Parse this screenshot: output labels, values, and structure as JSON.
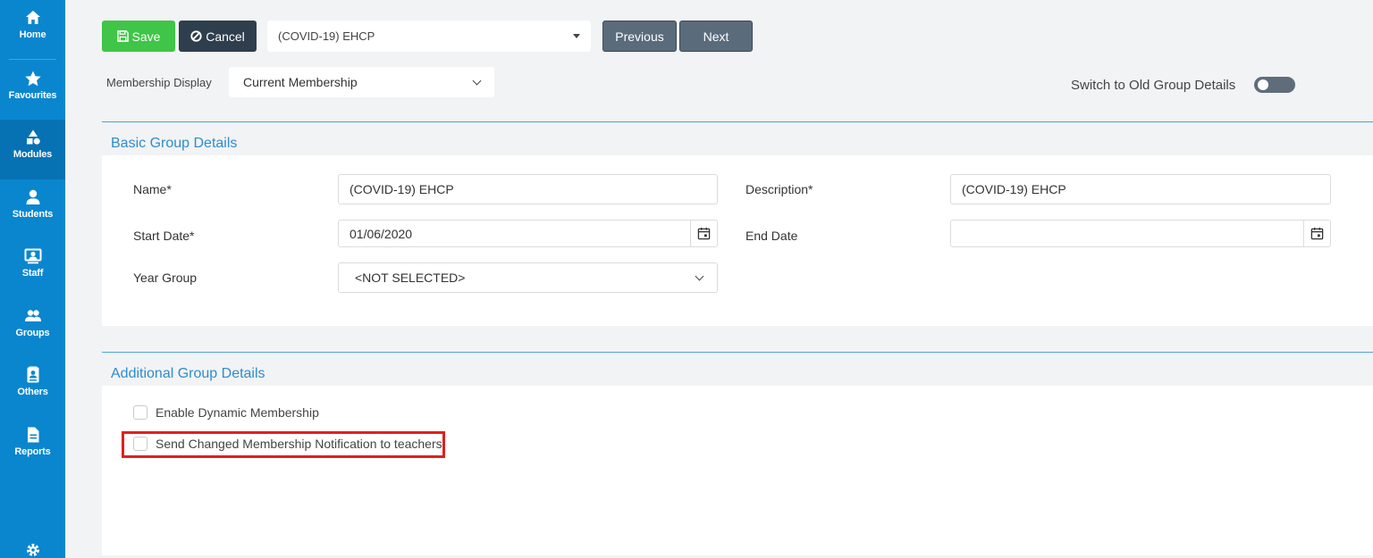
{
  "sidebar": {
    "items": [
      {
        "label": "Home",
        "icon": "home-icon"
      },
      {
        "label": "Favourites",
        "icon": "star-icon"
      },
      {
        "label": "Modules",
        "icon": "modules-icon"
      },
      {
        "label": "Students",
        "icon": "person-icon"
      },
      {
        "label": "Staff",
        "icon": "staff-icon"
      },
      {
        "label": "Groups",
        "icon": "groups-icon"
      },
      {
        "label": "Others",
        "icon": "contact-book-icon"
      },
      {
        "label": "Reports",
        "icon": "document-icon"
      },
      {
        "label": "",
        "icon": "gear-icon"
      }
    ],
    "active": "Modules"
  },
  "toolbar": {
    "save_label": "Save",
    "cancel_label": "Cancel",
    "group_selected": "(COVID-19) EHCP",
    "previous_label": "Previous",
    "next_label": "Next"
  },
  "membership_display": {
    "label": "Membership Display",
    "value": "Current Membership"
  },
  "switch_old": {
    "label": "Switch to Old Group Details",
    "on": false
  },
  "basic": {
    "title": "Basic Group Details",
    "name_label": "Name*",
    "name_value": "(COVID-19) EHCP",
    "description_label": "Description*",
    "description_value": "(COVID-19) EHCP",
    "start_label": "Start Date*",
    "start_value": "01/06/2020",
    "end_label": "End Date",
    "end_value": "",
    "year_label": "Year Group",
    "year_value": "<NOT SELECTED>"
  },
  "additional": {
    "title": "Additional Group Details",
    "dynamic_label": "Enable Dynamic Membership",
    "dynamic_checked": false,
    "notify_label": "Send Changed Membership Notification to teachers",
    "notify_checked": false
  },
  "colors": {
    "sidebar": "#0a86cf",
    "save": "#3fc547",
    "cancel": "#2f3e4c",
    "accent": "#2f8ccc",
    "highlight": "#e0201f"
  }
}
